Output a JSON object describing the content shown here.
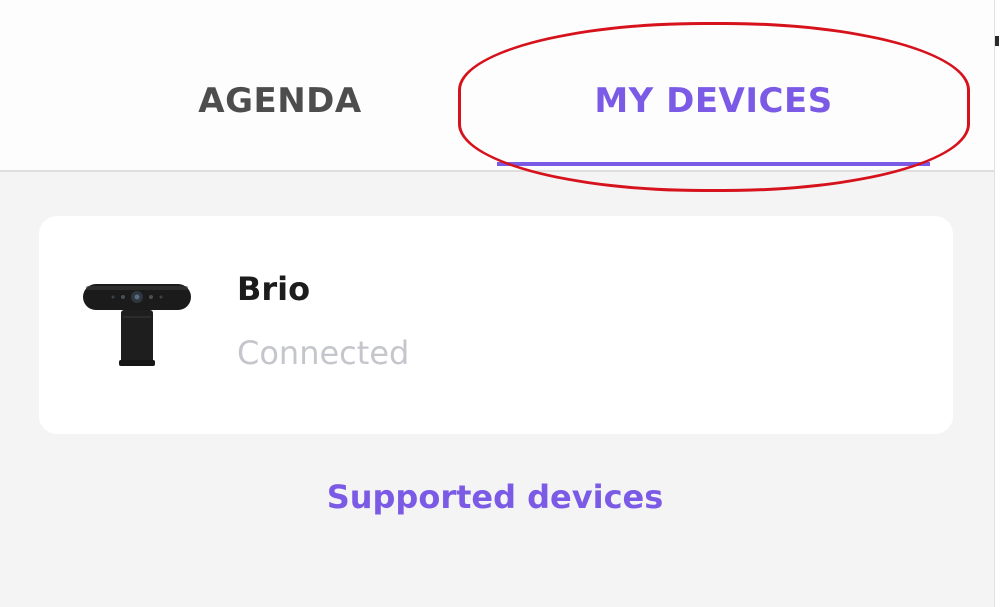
{
  "colors": {
    "accent": "#7b5be6",
    "highlight_ring": "#d6121c",
    "tab_inactive": "#4d4d4d"
  },
  "tabs": [
    {
      "label": "AGENDA",
      "active": false
    },
    {
      "label": "MY DEVICES",
      "active": true
    }
  ],
  "device": {
    "name": "Brio",
    "status": "Connected",
    "icon": "webcam-icon"
  },
  "footer": {
    "supported_link": "Supported devices"
  }
}
